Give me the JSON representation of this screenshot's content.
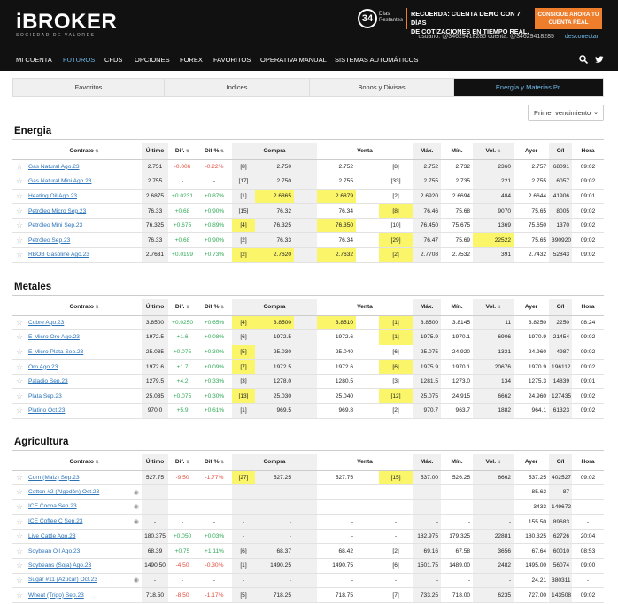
{
  "brand": {
    "logo": "iBROKER",
    "tagline": "SOCIEDAD DE VALORES"
  },
  "countdown": {
    "number": "34",
    "label": "Días Restantes"
  },
  "promo": {
    "line1": "RECUERDA: CUENTA DEMO CON 7 DÍAS",
    "line2": "DE COTIZACIONES EN TIEMPO REAL.",
    "cta": "CONSIGUE AHORA TU CUENTA REAL"
  },
  "user": {
    "text": "usuario: @34629418285 cuenta: @34629418285",
    "logout": "desconectar"
  },
  "nav": [
    "MI CUENTA",
    "FUTUROS",
    "CFDS",
    "OPCIONES",
    "FOREX",
    "FAVORITOS",
    "OPERATIVA MANUAL",
    "SISTEMAS AUTOMÁTICOS"
  ],
  "tabs": [
    "Favoritos",
    "Indices",
    "Bonos y Divisas",
    "Energía y Materias Pr."
  ],
  "sort": "Primer vencimiento",
  "columns": [
    "Contrato",
    "Último",
    "Dif.",
    "Dif %",
    "Compra",
    "Venta",
    "Máx.",
    "Mín.",
    "Vol.",
    "Ayer",
    "O/I",
    "Hora"
  ],
  "sections": [
    {
      "title": "Energia",
      "rows": [
        {
          "name": "Gas Natural Ago.23",
          "last": "2.751",
          "dif": "-0.006",
          "difp": "-0.22%",
          "dir": "neg",
          "bq": "[8]",
          "bid": "2.750",
          "ask": "2.752",
          "aq": "[8]",
          "max": "2.752",
          "min": "2.732",
          "vol": "2360",
          "prev": "2.757",
          "oi": "68091",
          "time": "09:02",
          "hl": []
        },
        {
          "name": "Gas Natural Mini Ago.23",
          "last": "2.755",
          "dif": "-",
          "difp": "-",
          "dir": "",
          "bq": "[17]",
          "bid": "2.750",
          "ask": "2.755",
          "aq": "[33]",
          "max": "2.755",
          "min": "2.735",
          "vol": "221",
          "prev": "2.755",
          "oi": "6057",
          "time": "09:02",
          "hl": []
        },
        {
          "name": "Heating Oil Ago.23",
          "last": "2.6875",
          "dif": "+0.0231",
          "difp": "+0.87%",
          "dir": "pos",
          "bq": "[1]",
          "bid": "2.6865",
          "ask": "2.6879",
          "aq": "[2]",
          "max": "2.6920",
          "min": "2.6694",
          "vol": "484",
          "prev": "2.6644",
          "oi": "41906",
          "time": "09:01",
          "hl": [
            "bid",
            "ask"
          ]
        },
        {
          "name": "Petróleo Micro Sep.23",
          "last": "76.33",
          "dif": "+0.68",
          "difp": "+0.90%",
          "dir": "pos",
          "bq": "[15]",
          "bid": "76.32",
          "ask": "76.34",
          "aq": "[8]",
          "max": "76.46",
          "min": "75.68",
          "vol": "9070",
          "prev": "75.65",
          "oi": "8005",
          "time": "09:02",
          "hl": [
            "aq"
          ]
        },
        {
          "name": "Petróleo Mini Sep.23",
          "last": "76.325",
          "dif": "+0.675",
          "difp": "+0.89%",
          "dir": "pos",
          "bq": "[4]",
          "bid": "76.325",
          "ask": "76.350",
          "aq": "[10]",
          "max": "76.450",
          "min": "75.675",
          "vol": "1369",
          "prev": "75.650",
          "oi": "1370",
          "time": "09:02",
          "hl": [
            "bq",
            "ask"
          ]
        },
        {
          "name": "Petróleo Sep.23",
          "last": "76.33",
          "dif": "+0.68",
          "difp": "+0.90%",
          "dir": "pos",
          "bq": "[2]",
          "bid": "76.33",
          "ask": "76.34",
          "aq": "[29]",
          "max": "76.47",
          "min": "75.69",
          "vol": "22522",
          "prev": "75.65",
          "oi": "390920",
          "time": "09:02",
          "hl": [
            "aq",
            "vol"
          ]
        },
        {
          "name": "RBOB Gasoline Ago.23",
          "last": "2.7631",
          "dif": "+0.0199",
          "difp": "+0.73%",
          "dir": "pos",
          "bq": "[2]",
          "bid": "2.7620",
          "ask": "2.7632",
          "aq": "[2]",
          "max": "2.7708",
          "min": "2.7532",
          "vol": "391",
          "prev": "2.7432",
          "oi": "52843",
          "time": "09:02",
          "hl": [
            "bid",
            "ask",
            "bq",
            "aq"
          ]
        }
      ]
    },
    {
      "title": "Metales",
      "rows": [
        {
          "name": "Cobre Ago.23",
          "last": "3.8500",
          "dif": "+0.0250",
          "difp": "+0.65%",
          "dir": "pos",
          "bq": "[4]",
          "bid": "3.8500",
          "ask": "3.8510",
          "aq": "[1]",
          "max": "3.8500",
          "min": "3.8145",
          "vol": "11",
          "prev": "3.8250",
          "oi": "2250",
          "time": "08:24",
          "hl": [
            "bq",
            "bid",
            "ask",
            "aq"
          ]
        },
        {
          "name": "E-Micro Oro Ago.23",
          "last": "1972.5",
          "dif": "+1.6",
          "difp": "+0.08%",
          "dir": "pos",
          "bq": "[6]",
          "bid": "1972.5",
          "ask": "1972.6",
          "aq": "[1]",
          "max": "1975.9",
          "min": "1970.1",
          "vol": "6906",
          "prev": "1970.9",
          "oi": "21454",
          "time": "09:02",
          "hl": [
            "aq"
          ]
        },
        {
          "name": "E-Micro Plata Sep.23",
          "last": "25.035",
          "dif": "+0.075",
          "difp": "+0.30%",
          "dir": "pos",
          "bq": "[5]",
          "bid": "25.030",
          "ask": "25.040",
          "aq": "[6]",
          "max": "25.075",
          "min": "24.920",
          "vol": "1331",
          "prev": "24.960",
          "oi": "4987",
          "time": "09:02",
          "hl": [
            "bq"
          ]
        },
        {
          "name": "Oro Ago.23",
          "last": "1972.6",
          "dif": "+1.7",
          "difp": "+0.09%",
          "dir": "pos",
          "bq": "[7]",
          "bid": "1972.5",
          "ask": "1972.6",
          "aq": "[6]",
          "max": "1975.9",
          "min": "1970.1",
          "vol": "20676",
          "prev": "1970.9",
          "oi": "196112",
          "time": "09:02",
          "hl": [
            "bq",
            "aq"
          ]
        },
        {
          "name": "Paladio Sep.23",
          "last": "1279.5",
          "dif": "+4.2",
          "difp": "+0.33%",
          "dir": "pos",
          "bq": "[3]",
          "bid": "1278.0",
          "ask": "1280.5",
          "aq": "[3]",
          "max": "1281.5",
          "min": "1273.0",
          "vol": "134",
          "prev": "1275.3",
          "oi": "14839",
          "time": "09:01",
          "hl": []
        },
        {
          "name": "Plata Sep.23",
          "last": "25.035",
          "dif": "+0.075",
          "difp": "+0.30%",
          "dir": "pos",
          "bq": "[13]",
          "bid": "25.030",
          "ask": "25.040",
          "aq": "[12]",
          "max": "25.075",
          "min": "24.915",
          "vol": "6662",
          "prev": "24.960",
          "oi": "127435",
          "time": "09:02",
          "hl": [
            "bq",
            "aq"
          ]
        },
        {
          "name": "Platino Oct.23",
          "last": "970.0",
          "dif": "+5.9",
          "difp": "+0.61%",
          "dir": "pos",
          "bq": "[1]",
          "bid": "969.5",
          "ask": "969.8",
          "aq": "[2]",
          "max": "970.7",
          "min": "963.7",
          "vol": "1882",
          "prev": "964.1",
          "oi": "61323",
          "time": "09:02",
          "hl": []
        }
      ]
    },
    {
      "title": "Agricultura",
      "rows": [
        {
          "name": "Corn (Maíz) Sep.23",
          "last": "527.75",
          "dif": "-9.50",
          "difp": "-1.77%",
          "dir": "neg",
          "bq": "[27]",
          "bid": "527.25",
          "ask": "527.75",
          "aq": "[15]",
          "max": "537.00",
          "min": "526.25",
          "vol": "6662",
          "prev": "537.25",
          "oi": "402527",
          "time": "09:02",
          "hl": [
            "bq",
            "aq"
          ]
        },
        {
          "name": "Cotton #2 (Algodón) Oct.23",
          "eye": true,
          "last": "-",
          "dif": "-",
          "difp": "-",
          "dir": "",
          "bq": "-",
          "bid": "-",
          "ask": "-",
          "aq": "-",
          "max": "-",
          "min": "-",
          "vol": "-",
          "prev": "85.62",
          "oi": "87",
          "time": "-",
          "hl": []
        },
        {
          "name": "ICE Cocoa Sep.23",
          "eye": true,
          "last": "-",
          "dif": "-",
          "difp": "-",
          "dir": "",
          "bq": "-",
          "bid": "-",
          "ask": "-",
          "aq": "-",
          "max": "-",
          "min": "-",
          "vol": "-",
          "prev": "3433",
          "oi": "149672",
          "time": "-",
          "hl": []
        },
        {
          "name": "ICE Coffee C Sep.23",
          "eye": true,
          "last": "-",
          "dif": "-",
          "difp": "-",
          "dir": "",
          "bq": "-",
          "bid": "-",
          "ask": "-",
          "aq": "-",
          "max": "-",
          "min": "-",
          "vol": "-",
          "prev": "155.50",
          "oi": "89683",
          "time": "-",
          "hl": []
        },
        {
          "name": "Live Cattle Ago.23",
          "last": "180.375",
          "dif": "+0.050",
          "difp": "+0.03%",
          "dir": "pos",
          "bq": "-",
          "bid": "-",
          "ask": "-",
          "aq": "-",
          "max": "182.975",
          "min": "179.325",
          "vol": "22881",
          "prev": "180.325",
          "oi": "62726",
          "time": "20:04",
          "hl": []
        },
        {
          "name": "Soybean Oil Ago.23",
          "last": "68.39",
          "dif": "+0.75",
          "difp": "+1.11%",
          "dir": "pos",
          "bq": "[6]",
          "bid": "68.37",
          "ask": "68.42",
          "aq": "[2]",
          "max": "69.16",
          "min": "67.58",
          "vol": "3656",
          "prev": "67.64",
          "oi": "60010",
          "time": "08:53",
          "hl": []
        },
        {
          "name": "Soybeans (Soja) Ago.23",
          "last": "1490.50",
          "dif": "-4.50",
          "difp": "-0.30%",
          "dir": "neg",
          "bq": "[1]",
          "bid": "1490.25",
          "ask": "1490.75",
          "aq": "[6]",
          "max": "1501.75",
          "min": "1489.00",
          "vol": "2482",
          "prev": "1495.00",
          "oi": "56074",
          "time": "09:00",
          "hl": []
        },
        {
          "name": "Sugar #11 (Azúcar) Oct.23",
          "eye": true,
          "last": "-",
          "dif": "-",
          "difp": "-",
          "dir": "",
          "bq": "-",
          "bid": "-",
          "ask": "-",
          "aq": "-",
          "max": "-",
          "min": "-",
          "vol": "-",
          "prev": "24.21",
          "oi": "380311",
          "time": "-",
          "hl": []
        },
        {
          "name": "Wheat (Trigo) Sep.23",
          "last": "718.50",
          "dif": "-8.50",
          "difp": "-1.17%",
          "dir": "neg",
          "bq": "[5]",
          "bid": "718.25",
          "ask": "718.75",
          "aq": "[7]",
          "max": "733.25",
          "min": "718.00",
          "vol": "6235",
          "prev": "727.00",
          "oi": "143508",
          "time": "09:02",
          "hl": []
        }
      ]
    }
  ]
}
